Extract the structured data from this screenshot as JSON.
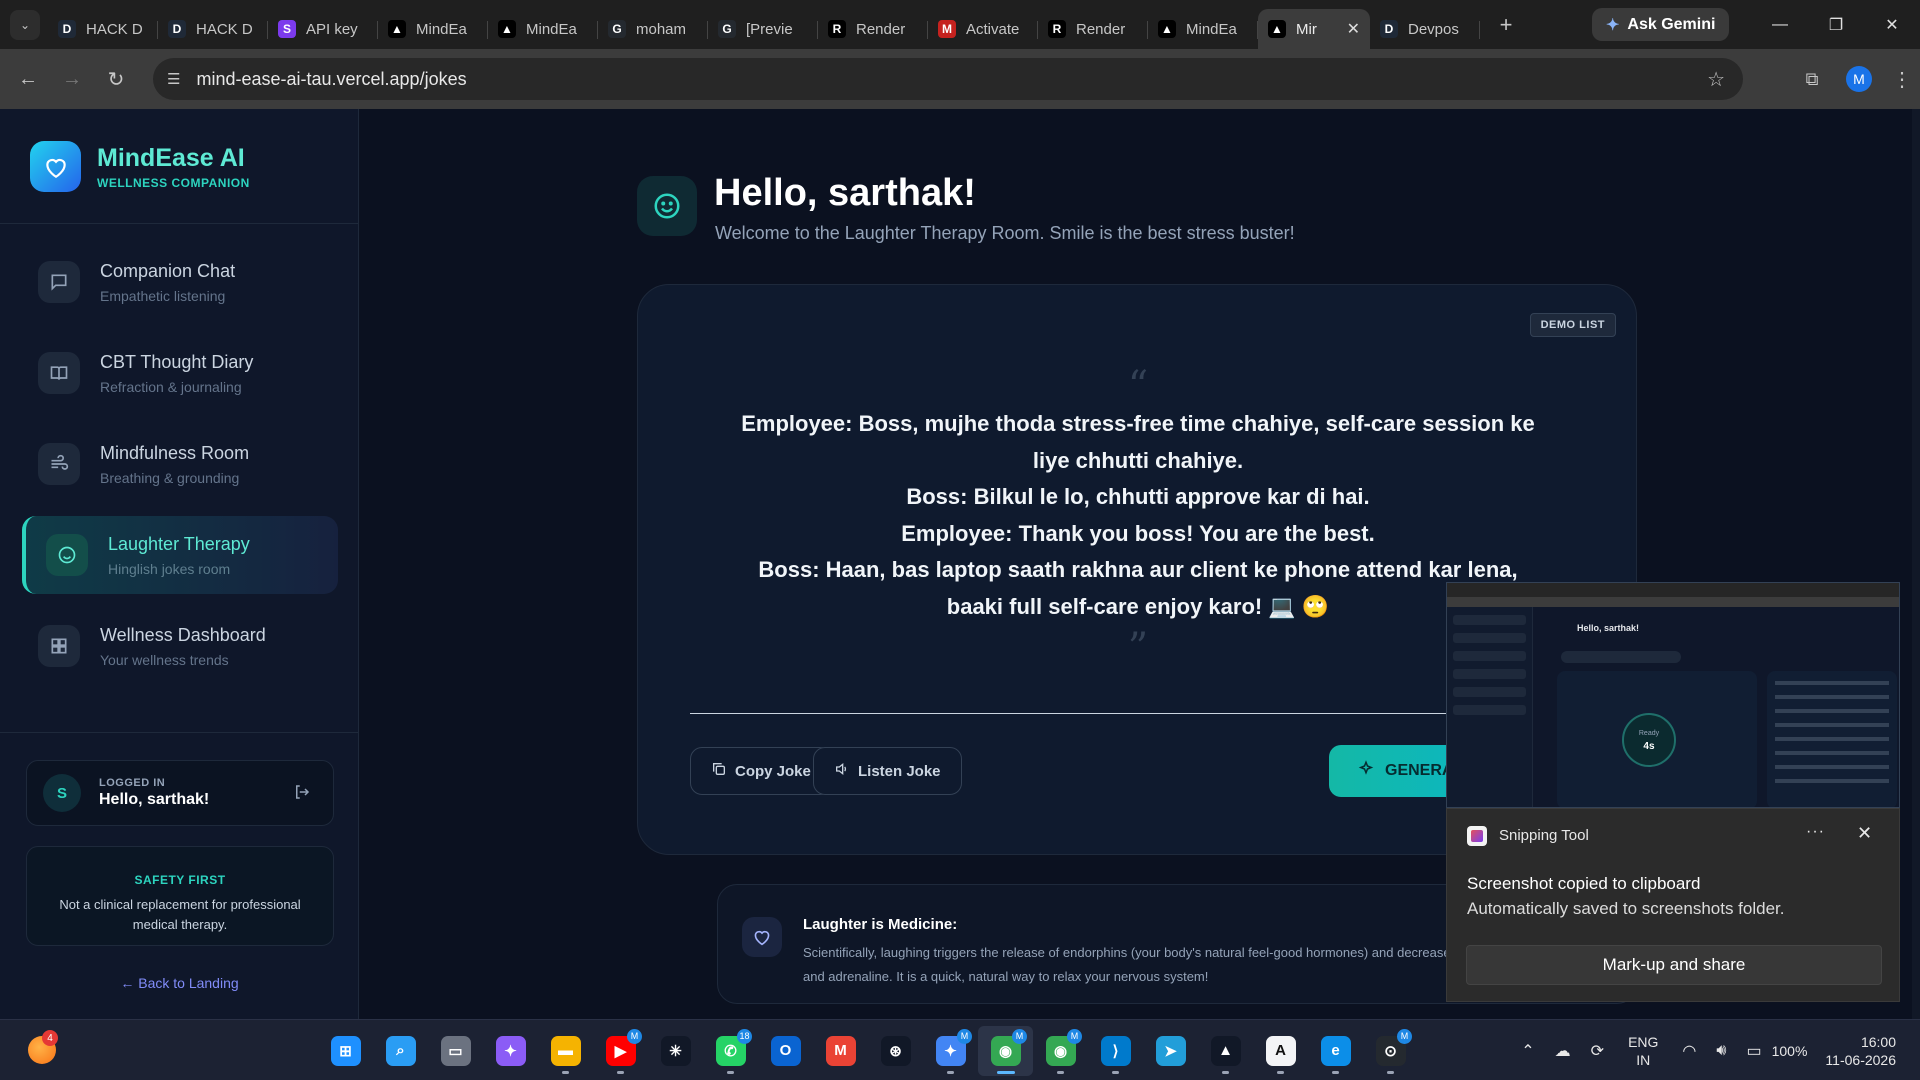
{
  "browser": {
    "tabs": [
      {
        "label": "HACK D",
        "favicon": "D",
        "color": "#1f2937"
      },
      {
        "label": "HACK D",
        "favicon": "D",
        "color": "#1f2937"
      },
      {
        "label": "API key",
        "favicon": "S",
        "color": "#7c3aed"
      },
      {
        "label": "MindEa",
        "favicon": "▲",
        "color": "#000000"
      },
      {
        "label": "MindEa",
        "favicon": "▲",
        "color": "#000000"
      },
      {
        "label": "moham",
        "favicon": "G",
        "color": "#24292f"
      },
      {
        "label": "[Previe",
        "favicon": "G",
        "color": "#24292f"
      },
      {
        "label": "Render",
        "favicon": "R",
        "color": "#000000"
      },
      {
        "label": "Activate",
        "favicon": "M",
        "color": "#c5221f"
      },
      {
        "label": "Render",
        "favicon": "R",
        "color": "#000000"
      },
      {
        "label": "MindEa",
        "favicon": "▲",
        "color": "#000000"
      },
      {
        "label": "Mir",
        "favicon": "▲",
        "color": "#000000",
        "active": true
      },
      {
        "label": "Devpos",
        "favicon": "D",
        "color": "#1f2937"
      }
    ],
    "ask_gemini": "Ask Gemini",
    "url": "mind-ease-ai-tau.vercel.app/jokes",
    "profile_initial": "M"
  },
  "sidebar": {
    "brand_name": "MindEase AI",
    "brand_sub": "WELLNESS COMPANION",
    "items": [
      {
        "title": "Companion Chat",
        "sub": "Empathetic listening",
        "icon": "chat-icon"
      },
      {
        "title": "CBT Thought Diary",
        "sub": "Refraction & journaling",
        "icon": "book-icon"
      },
      {
        "title": "Mindfulness Room",
        "sub": "Breathing & grounding",
        "icon": "wind-icon"
      },
      {
        "title": "Laughter Therapy",
        "sub": "Hinglish jokes room",
        "icon": "smile-icon",
        "active": true
      },
      {
        "title": "Wellness Dashboard",
        "sub": "Your wellness trends",
        "icon": "dashboard-icon"
      }
    ],
    "user": {
      "initial": "S",
      "tag": "LOGGED IN",
      "name": "Hello, sarthak!"
    },
    "safety": {
      "title": "SAFETY FIRST",
      "text": "Not a clinical replacement for professional medical therapy."
    },
    "back_link": "← Back to Landing"
  },
  "main": {
    "title": "Hello, sarthak!",
    "subtitle": "Welcome to the Laughter Therapy Room. Smile is the best stress buster!",
    "badge": "DEMO LIST",
    "quote_open": "“",
    "quote_close": "”",
    "joke_lines": [
      "Employee: Boss, mujhe thoda stress-free time chahiye, self-care session ke liye chhutti chahiye.",
      "Boss: Bilkul le lo, chhutti approve kar di hai.",
      "Employee: Thank you boss! You are the best.",
      "Boss: Haan, bas laptop saath rakhna aur client ke phone attend kar lena, baaki full self-care enjoy karo! 💻 🙄"
    ],
    "copy_label": "Copy Joke",
    "listen_label": "Listen Joke",
    "generate_label": "GENERATE",
    "info": {
      "title": "Laughter is Medicine:",
      "text": "Scientifically, laughing triggers the release of endorphins (your body's natural feel-good hormones) and decreases stress indicators like cortisol and adrenaline. It is a quick, natural way to relax your nervous system!"
    }
  },
  "snip_preview": {
    "title": "Hello, sarthak!",
    "circle_top": "Ready",
    "circle_bottom": "4s"
  },
  "toast": {
    "app": "Snipping Tool",
    "more": "···",
    "title": "Screenshot copied to clipboard",
    "body": "Automatically saved to screenshots folder.",
    "button": "Mark-up and share"
  },
  "taskbar": {
    "widget_badge": "4",
    "apps": [
      {
        "name": "start",
        "color": "#1e90ff",
        "glyph": "⊞"
      },
      {
        "name": "search",
        "color": "#2a9df4",
        "glyph": "⌕"
      },
      {
        "name": "task-view",
        "color": "#6b7280",
        "glyph": "▭"
      },
      {
        "name": "copilot",
        "color": "#8b5cf6",
        "glyph": "✦"
      },
      {
        "name": "file-explorer",
        "color": "#f5b301",
        "glyph": "▬",
        "running": true
      },
      {
        "name": "youtube",
        "color": "#ff0000",
        "glyph": "▶",
        "badge": "M",
        "running": true
      },
      {
        "name": "perplexity",
        "color": "#111827",
        "glyph": "✳"
      },
      {
        "name": "whatsapp",
        "color": "#25d366",
        "glyph": "✆",
        "badge": "18",
        "running": true
      },
      {
        "name": "outlook",
        "color": "#0a64d1",
        "glyph": "O"
      },
      {
        "name": "gmail",
        "color": "#ea4335",
        "glyph": "M"
      },
      {
        "name": "chatgpt",
        "color": "#111827",
        "glyph": "⊛"
      },
      {
        "name": "gemini",
        "color": "#4285f4",
        "glyph": "✦",
        "badge": "M",
        "running": true
      },
      {
        "name": "chrome",
        "color": "#34a853",
        "glyph": "◉",
        "badge": "M",
        "running": true,
        "focused": true
      },
      {
        "name": "chrome-profile",
        "color": "#34a853",
        "glyph": "◉",
        "badge": "M",
        "running": true
      },
      {
        "name": "vscode",
        "color": "#007acc",
        "glyph": "⟩",
        "running": true
      },
      {
        "name": "telegram",
        "color": "#229ed9",
        "glyph": "➤"
      },
      {
        "name": "vercel",
        "color": "#111827",
        "glyph": "▲",
        "running": true
      },
      {
        "name": "antigravity",
        "color": "#f3f4f6",
        "glyph": "A",
        "running": true
      },
      {
        "name": "edge",
        "color": "#0c8ee8",
        "glyph": "e",
        "running": true
      },
      {
        "name": "github",
        "color": "#24292f",
        "glyph": "⊙",
        "badge": "M",
        "running": true
      }
    ],
    "lang_top": "ENG",
    "lang_bottom": "IN",
    "battery": "100%",
    "time": "16:00",
    "date": "11-06-2026"
  }
}
